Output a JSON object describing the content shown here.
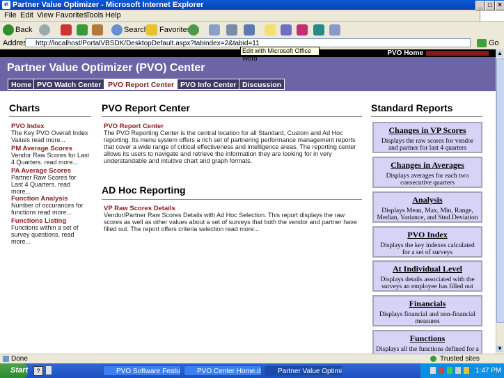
{
  "window": {
    "title": "Partner Value Optimizer - Microsoft Internet Explorer"
  },
  "menu": [
    "File",
    "Edit",
    "View",
    "Favorites",
    "Tools",
    "Help"
  ],
  "toolbar": {
    "back": "Back",
    "search": "Search",
    "favorites": "Favorites"
  },
  "address": {
    "label": "Address",
    "url": "http://localhost/PortalVBSDK/DesktopDefault.aspx?tabindex=2&tabid=11",
    "go": "Go"
  },
  "tooltip": "Edit with Microsoft Office Word",
  "site": {
    "home_link": "PVO Home",
    "title": "Partner Value Optimizer (PVO) Center",
    "tabs": [
      {
        "label": "Home",
        "active": false
      },
      {
        "label": "PVO Watch Center",
        "active": false
      },
      {
        "label": "PVO Report Center",
        "active": true
      },
      {
        "label": "PVO Info Center",
        "active": false
      },
      {
        "label": "Discussion",
        "active": false
      }
    ]
  },
  "charts": {
    "title": "Charts",
    "items": [
      {
        "title": "PVO Index",
        "body": "The Key PVO Overall Index Values   read more..."
      },
      {
        "title": "PM Average Scores",
        "body": "Vendor Raw Scores for Last 4 Quarters.   read more..."
      },
      {
        "title": "PA Average Scores",
        "body": "Partner Raw Scores for Last 4 Quarters.   read more..."
      },
      {
        "title": "Function Analysis",
        "body": "Number of occurances for functions   read more..."
      },
      {
        "title": "Functions Listing",
        "body": "Functions within a set of survey questions.   read more..."
      }
    ]
  },
  "report_center": {
    "title": "PVO Report Center",
    "item_title": "PVO Report Center",
    "item_body": "The PVO Reporting Center is the central location for all Standard, Custom and Ad Hoc reporting. Its menu system offers a rich set of partnering performance management reports that cover a wide range of critical effectiveness and intelligence areas. The reporting center allows its users to navigate and retrieve the information they are looking for in very understandable and intuitive chart and graph formats."
  },
  "adhoc": {
    "title": "AD Hoc Reporting",
    "item_title": "VP Raw Scores Details",
    "item_body": "Vendor/Partner Raw Scores Details with Ad Hoc Selection. This report displays the raw scores as well as other values about a set of surveys that both the vendor and partner have filled out. The report offers criteria selection   read more..."
  },
  "standard_reports": {
    "title": "Standard Reports",
    "items": [
      {
        "title": "Changes in VP Scores",
        "body": "Displays the raw scores for vendor and partner for last 4 quarters"
      },
      {
        "title": "Changes in Averages",
        "body": "Displays averages for each two consecutive quarters"
      },
      {
        "title": "Analysis",
        "body": "Displays Mean, Max, Min, Range, Median, Variance, and Stnd.Deviation"
      },
      {
        "title": "PVO Index",
        "body": "Displays the key indexes calculated for a set of surveys"
      },
      {
        "title": "At Individual Level",
        "body": "Displays details associated with the surveys an employee has filled out"
      },
      {
        "title": "Financials",
        "body": "Displays financial and non-financial measures"
      },
      {
        "title": "Functions",
        "body": "Displays all the functions defined for a"
      }
    ]
  },
  "status": {
    "left": "Done",
    "zone": "Trusted sites"
  },
  "taskbar": {
    "start": "Start",
    "tasks": [
      "PVO Software Features....",
      "PVO Center Home.docx -...",
      "Partner Value Optimiz..."
    ],
    "clock": "1:47 PM"
  }
}
